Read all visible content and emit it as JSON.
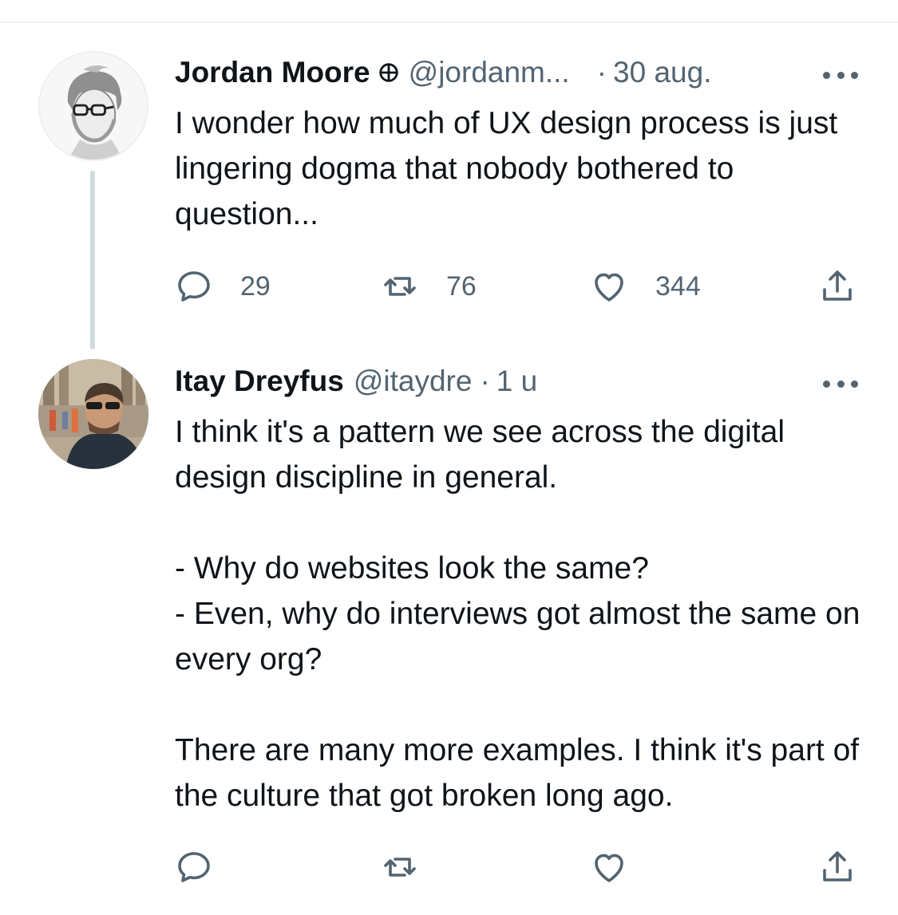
{
  "colors": {
    "text_primary": "#0f1419",
    "text_secondary": "#536471",
    "thread_line": "#cfd9de",
    "divider": "#eff3f4"
  },
  "tweets": [
    {
      "author": "Jordan Moore",
      "badge_icon": "globe-crosshair-icon",
      "handle": "@jordanm...",
      "separator": "·",
      "time": "30 aug.",
      "text": "I wonder how much of UX design process is just lingering dogma that nobody bothered to question...",
      "stats": {
        "replies": "29",
        "retweets": "76",
        "likes": "344"
      }
    },
    {
      "author": "Itay Dreyfus",
      "handle": "@itaydre",
      "separator": "·",
      "time": "1 u",
      "text": "I think it's a pattern we see across the digital design discipline in general.\n\n- Why do websites look the same?\n- Even, why do interviews got almost the same on every org?\n\nThere are many more examples. I think it's part of the culture that got broken long ago."
    }
  ]
}
